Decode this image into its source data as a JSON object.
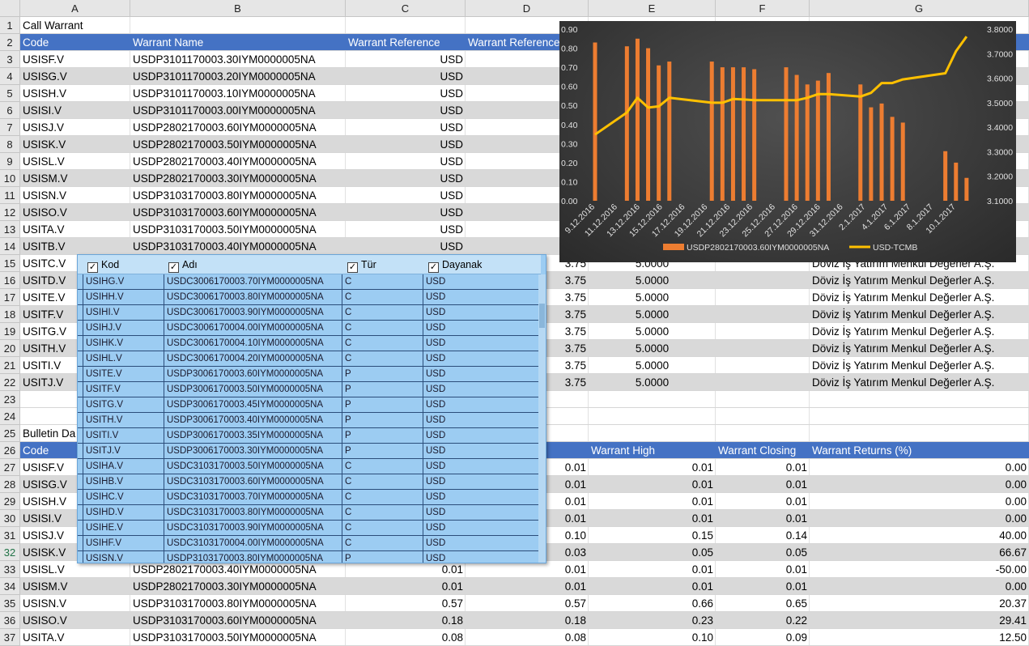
{
  "columns": [
    "A",
    "B",
    "C",
    "D",
    "E",
    "F",
    "G"
  ],
  "row_numbers": [
    "1",
    "2",
    "3",
    "4",
    "5",
    "6",
    "7",
    "8",
    "9",
    "10",
    "11",
    "12",
    "13",
    "14",
    "15",
    "16",
    "17",
    "18",
    "19",
    "20",
    "21",
    "22",
    "23",
    "24",
    "25",
    "26",
    "27",
    "28",
    "29",
    "30",
    "31",
    "32",
    "33",
    "34",
    "35",
    "36",
    "37"
  ],
  "selected_row": "32",
  "section1": {
    "title": "Call Warrant",
    "headers": [
      "Code",
      "Warrant Name",
      "Warrant Reference",
      "Warrant Reference"
    ],
    "rows": [
      {
        "code": "USISF.V",
        "name": "USDP3101170003.30IYM0000005NA",
        "ref": "USD"
      },
      {
        "code": "USISG.V",
        "name": "USDP3101170003.20IYM0000005NA",
        "ref": "USD"
      },
      {
        "code": "USISH.V",
        "name": "USDP3101170003.10IYM0000005NA",
        "ref": "USD"
      },
      {
        "code": "USISI.V",
        "name": "USDP3101170003.00IYM0000005NA",
        "ref": "USD"
      },
      {
        "code": "USISJ.V",
        "name": "USDP2802170003.60IYM0000005NA",
        "ref": "USD"
      },
      {
        "code": "USISK.V",
        "name": "USDP2802170003.50IYM0000005NA",
        "ref": "USD"
      },
      {
        "code": "USISL.V",
        "name": "USDP2802170003.40IYM0000005NA",
        "ref": "USD"
      },
      {
        "code": "USISM.V",
        "name": "USDP2802170003.30IYM0000005NA",
        "ref": "USD"
      },
      {
        "code": "USISN.V",
        "name": "USDP3103170003.80IYM0000005NA",
        "ref": "USD"
      },
      {
        "code": "USISO.V",
        "name": "USDP3103170003.60IYM0000005NA",
        "ref": "USD"
      },
      {
        "code": "USITA.V",
        "name": "USDP3103170003.50IYM0000005NA",
        "ref": "USD"
      },
      {
        "code": "USITB.V",
        "name": "USDP3103170003.40IYM0000005NA",
        "ref": "USD"
      }
    ],
    "rows_lower": [
      {
        "code": "USITC.V",
        "d": "3.75",
        "e": "5.0000",
        "g": "Döviz İş Yatırım Menkul Değerler A.Ş."
      },
      {
        "code": "USITD.V",
        "d": "3.75",
        "e": "5.0000",
        "g": "Döviz İş Yatırım Menkul Değerler A.Ş."
      },
      {
        "code": "USITE.V",
        "d": "3.75",
        "e": "5.0000",
        "g": "Döviz İş Yatırım Menkul Değerler A.Ş."
      },
      {
        "code": "USITF.V",
        "d": "3.75",
        "e": "5.0000",
        "g": "Döviz İş Yatırım Menkul Değerler A.Ş."
      },
      {
        "code": "USITG.V",
        "d": "3.75",
        "e": "5.0000",
        "g": "Döviz İş Yatırım Menkul Değerler A.Ş."
      },
      {
        "code": "USITH.V",
        "d": "3.75",
        "e": "5.0000",
        "g": "Döviz İş Yatırım Menkul Değerler A.Ş."
      },
      {
        "code": "USITI.V",
        "d": "3.75",
        "e": "5.0000",
        "g": "Döviz İş Yatırım Menkul Değerler A.Ş."
      },
      {
        "code": "USITJ.V",
        "d": "3.75",
        "e": "5.0000",
        "g": "Döviz İş Yatırım Menkul Değerler A.Ş."
      }
    ]
  },
  "section2": {
    "title": "Bulletin Da",
    "headers": {
      "code": "Code",
      "e": "Warrant High",
      "f": "Warrant Closing",
      "g": "Warrant Returns (%)"
    },
    "rows": [
      {
        "code": "USISF.V",
        "name": "",
        "c": "",
        "d": "0.01",
        "e": "0.01",
        "f": "0.01",
        "g": "0.00"
      },
      {
        "code": "USISG.V",
        "name": "",
        "c": "",
        "d": "0.01",
        "e": "0.01",
        "f": "0.01",
        "g": "0.00"
      },
      {
        "code": "USISH.V",
        "name": "",
        "c": "",
        "d": "0.01",
        "e": "0.01",
        "f": "0.01",
        "g": "0.00"
      },
      {
        "code": "USISI.V",
        "name": "",
        "c": "",
        "d": "0.01",
        "e": "0.01",
        "f": "0.01",
        "g": "0.00"
      },
      {
        "code": "USISJ.V",
        "name": "",
        "c": "",
        "d": "0.10",
        "e": "0.15",
        "f": "0.14",
        "g": "40.00"
      },
      {
        "code": "USISK.V",
        "name": "",
        "c": "",
        "d": "0.03",
        "e": "0.05",
        "f": "0.05",
        "g": "66.67"
      },
      {
        "code": "USISL.V",
        "name": "USDP2802170003.40IYM0000005NA",
        "c": "0.01",
        "d": "0.01",
        "e": "0.01",
        "f": "0.01",
        "g": "-50.00"
      },
      {
        "code": "USISM.V",
        "name": "USDP2802170003.30IYM0000005NA",
        "c": "0.01",
        "d": "0.01",
        "e": "0.01",
        "f": "0.01",
        "g": "0.00"
      },
      {
        "code": "USISN.V",
        "name": "USDP3103170003.80IYM0000005NA",
        "c": "0.57",
        "d": "0.57",
        "e": "0.66",
        "f": "0.65",
        "g": "20.37"
      },
      {
        "code": "USISO.V",
        "name": "USDP3103170003.60IYM0000005NA",
        "c": "0.18",
        "d": "0.18",
        "e": "0.23",
        "f": "0.22",
        "g": "29.41"
      },
      {
        "code": "USITA.V",
        "name": "USDP3103170003.50IYM0000005NA",
        "c": "0.08",
        "d": "0.08",
        "e": "0.10",
        "f": "0.09",
        "g": "12.50"
      }
    ]
  },
  "popup": {
    "headers": [
      "Kod",
      "Adı",
      "Tür",
      "Dayanak"
    ],
    "rows": [
      [
        "USIHG.V",
        "USDC3006170003.70IYM0000005NA",
        "C",
        "USD"
      ],
      [
        "USIHH.V",
        "USDC3006170003.80IYM0000005NA",
        "C",
        "USD"
      ],
      [
        "USIHI.V",
        "USDC3006170003.90IYM0000005NA",
        "C",
        "USD"
      ],
      [
        "USIHJ.V",
        "USDC3006170004.00IYM0000005NA",
        "C",
        "USD"
      ],
      [
        "USIHK.V",
        "USDC3006170004.10IYM0000005NA",
        "C",
        "USD"
      ],
      [
        "USIHL.V",
        "USDC3006170004.20IYM0000005NA",
        "C",
        "USD"
      ],
      [
        "USITE.V",
        "USDP3006170003.60IYM0000005NA",
        "P",
        "USD"
      ],
      [
        "USITF.V",
        "USDP3006170003.50IYM0000005NA",
        "P",
        "USD"
      ],
      [
        "USITG.V",
        "USDP3006170003.45IYM0000005NA",
        "P",
        "USD"
      ],
      [
        "USITH.V",
        "USDP3006170003.40IYM0000005NA",
        "P",
        "USD"
      ],
      [
        "USITI.V",
        "USDP3006170003.35IYM0000005NA",
        "P",
        "USD"
      ],
      [
        "USITJ.V",
        "USDP3006170003.30IYM0000005NA",
        "P",
        "USD"
      ],
      [
        "USIHA.V",
        "USDC3103170003.50IYM0000005NA",
        "C",
        "USD"
      ],
      [
        "USIHB.V",
        "USDC3103170003.60IYM0000005NA",
        "C",
        "USD"
      ],
      [
        "USIHC.V",
        "USDC3103170003.70IYM0000005NA",
        "C",
        "USD"
      ],
      [
        "USIHD.V",
        "USDC3103170003.80IYM0000005NA",
        "C",
        "USD"
      ],
      [
        "USIHE.V",
        "USDC3103170003.90IYM0000005NA",
        "C",
        "USD"
      ],
      [
        "USIHF.V",
        "USDC3103170004.00IYM0000005NA",
        "C",
        "USD"
      ],
      [
        "USISN.V",
        "USDP3103170003.80IYM0000005NA",
        "P",
        "USD"
      ]
    ]
  },
  "chart_data": {
    "type": "bar+line",
    "title": "",
    "xlabel": "",
    "categories": [
      "9.12.2016",
      "11.12.2016",
      "13.12.2016",
      "15.12.2016",
      "17.12.2016",
      "19.12.2016",
      "21.12.2016",
      "23.12.2016",
      "25.12.2016",
      "27.12.2016",
      "29.12.2016",
      "31.12.2016",
      "2.1.2017",
      "4.1.2017",
      "6.1.2017",
      "8.1.2017",
      "10.1.2017"
    ],
    "ylim_left": [
      0,
      0.9
    ],
    "yticks_left": [
      "0.90",
      "0.80",
      "0.70",
      "0.60",
      "0.50",
      "0.40",
      "0.30",
      "0.20",
      "0.10",
      "0.00"
    ],
    "ylim_right": [
      3.1,
      3.8
    ],
    "yticks_right": [
      "3.8000",
      "3.7000",
      "3.6000",
      "3.5000",
      "3.4000",
      "3.3000",
      "3.2000",
      "3.1000"
    ],
    "series": [
      {
        "name": "USDP2802170003.60IYM0000005NA",
        "type": "bar",
        "axis": "left",
        "color": "#ed7d31",
        "points": [
          [
            0,
            0.83
          ],
          [
            3,
            0.81
          ],
          [
            4,
            0.85
          ],
          [
            5,
            0.8
          ],
          [
            6,
            0.71
          ],
          [
            7,
            0.73
          ],
          [
            11,
            0.73
          ],
          [
            12,
            0.7
          ],
          [
            13,
            0.7
          ],
          [
            14,
            0.7
          ],
          [
            15,
            0.69
          ],
          [
            18,
            0.7
          ],
          [
            19,
            0.66
          ],
          [
            20,
            0.61
          ],
          [
            21,
            0.63
          ],
          [
            22,
            0.67
          ],
          [
            25,
            0.61
          ],
          [
            26,
            0.49
          ],
          [
            27,
            0.51
          ],
          [
            28,
            0.44
          ],
          [
            29,
            0.41
          ],
          [
            33,
            0.26
          ],
          [
            34,
            0.2
          ],
          [
            35,
            0.12
          ]
        ]
      },
      {
        "name": "USD-TCMB",
        "type": "line",
        "axis": "right",
        "color": "#ffc000",
        "points": [
          [
            0,
            3.37
          ],
          [
            3,
            3.46
          ],
          [
            4,
            3.52
          ],
          [
            5,
            3.48
          ],
          [
            6,
            3.485
          ],
          [
            7,
            3.52
          ],
          [
            11,
            3.5
          ],
          [
            12,
            3.5
          ],
          [
            13,
            3.515
          ],
          [
            14,
            3.513
          ],
          [
            15,
            3.51
          ],
          [
            18,
            3.51
          ],
          [
            19,
            3.51
          ],
          [
            20,
            3.52
          ],
          [
            21,
            3.535
          ],
          [
            22,
            3.535
          ],
          [
            25,
            3.525
          ],
          [
            26,
            3.54
          ],
          [
            27,
            3.58
          ],
          [
            28,
            3.58
          ],
          [
            29,
            3.595
          ],
          [
            33,
            3.62
          ],
          [
            34,
            3.71
          ],
          [
            35,
            3.77
          ]
        ]
      }
    ],
    "x_index_max": 36,
    "legend_position": "bottom",
    "grid": false
  }
}
